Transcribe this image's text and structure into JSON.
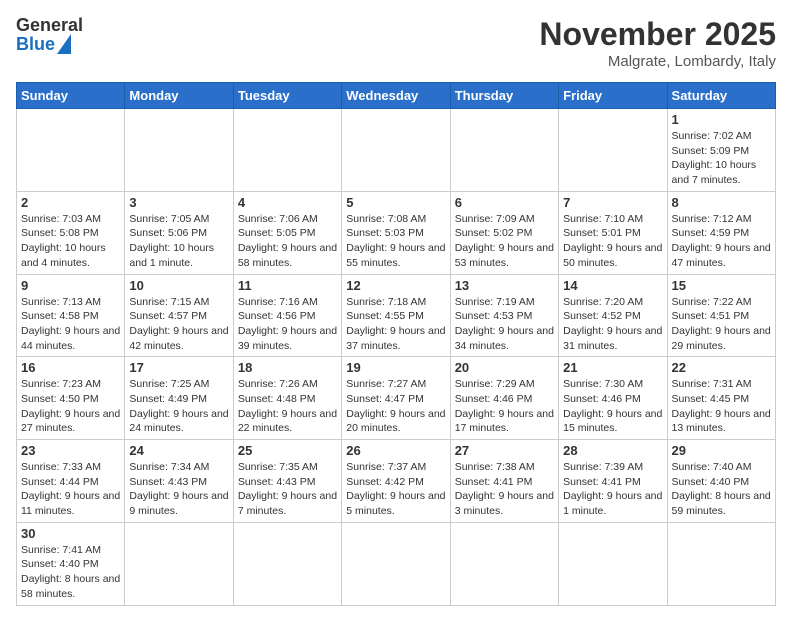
{
  "header": {
    "logo_general": "General",
    "logo_blue": "Blue",
    "month_year": "November 2025",
    "location": "Malgrate, Lombardy, Italy"
  },
  "weekdays": [
    "Sunday",
    "Monday",
    "Tuesday",
    "Wednesday",
    "Thursday",
    "Friday",
    "Saturday"
  ],
  "weeks": [
    [
      {
        "day": "",
        "info": ""
      },
      {
        "day": "",
        "info": ""
      },
      {
        "day": "",
        "info": ""
      },
      {
        "day": "",
        "info": ""
      },
      {
        "day": "",
        "info": ""
      },
      {
        "day": "",
        "info": ""
      },
      {
        "day": "1",
        "info": "Sunrise: 7:02 AM\nSunset: 5:09 PM\nDaylight: 10 hours and 7 minutes."
      }
    ],
    [
      {
        "day": "2",
        "info": "Sunrise: 7:03 AM\nSunset: 5:08 PM\nDaylight: 10 hours and 4 minutes."
      },
      {
        "day": "3",
        "info": "Sunrise: 7:05 AM\nSunset: 5:06 PM\nDaylight: 10 hours and 1 minute."
      },
      {
        "day": "4",
        "info": "Sunrise: 7:06 AM\nSunset: 5:05 PM\nDaylight: 9 hours and 58 minutes."
      },
      {
        "day": "5",
        "info": "Sunrise: 7:08 AM\nSunset: 5:03 PM\nDaylight: 9 hours and 55 minutes."
      },
      {
        "day": "6",
        "info": "Sunrise: 7:09 AM\nSunset: 5:02 PM\nDaylight: 9 hours and 53 minutes."
      },
      {
        "day": "7",
        "info": "Sunrise: 7:10 AM\nSunset: 5:01 PM\nDaylight: 9 hours and 50 minutes."
      },
      {
        "day": "8",
        "info": "Sunrise: 7:12 AM\nSunset: 4:59 PM\nDaylight: 9 hours and 47 minutes."
      }
    ],
    [
      {
        "day": "9",
        "info": "Sunrise: 7:13 AM\nSunset: 4:58 PM\nDaylight: 9 hours and 44 minutes."
      },
      {
        "day": "10",
        "info": "Sunrise: 7:15 AM\nSunset: 4:57 PM\nDaylight: 9 hours and 42 minutes."
      },
      {
        "day": "11",
        "info": "Sunrise: 7:16 AM\nSunset: 4:56 PM\nDaylight: 9 hours and 39 minutes."
      },
      {
        "day": "12",
        "info": "Sunrise: 7:18 AM\nSunset: 4:55 PM\nDaylight: 9 hours and 37 minutes."
      },
      {
        "day": "13",
        "info": "Sunrise: 7:19 AM\nSunset: 4:53 PM\nDaylight: 9 hours and 34 minutes."
      },
      {
        "day": "14",
        "info": "Sunrise: 7:20 AM\nSunset: 4:52 PM\nDaylight: 9 hours and 31 minutes."
      },
      {
        "day": "15",
        "info": "Sunrise: 7:22 AM\nSunset: 4:51 PM\nDaylight: 9 hours and 29 minutes."
      }
    ],
    [
      {
        "day": "16",
        "info": "Sunrise: 7:23 AM\nSunset: 4:50 PM\nDaylight: 9 hours and 27 minutes."
      },
      {
        "day": "17",
        "info": "Sunrise: 7:25 AM\nSunset: 4:49 PM\nDaylight: 9 hours and 24 minutes."
      },
      {
        "day": "18",
        "info": "Sunrise: 7:26 AM\nSunset: 4:48 PM\nDaylight: 9 hours and 22 minutes."
      },
      {
        "day": "19",
        "info": "Sunrise: 7:27 AM\nSunset: 4:47 PM\nDaylight: 9 hours and 20 minutes."
      },
      {
        "day": "20",
        "info": "Sunrise: 7:29 AM\nSunset: 4:46 PM\nDaylight: 9 hours and 17 minutes."
      },
      {
        "day": "21",
        "info": "Sunrise: 7:30 AM\nSunset: 4:46 PM\nDaylight: 9 hours and 15 minutes."
      },
      {
        "day": "22",
        "info": "Sunrise: 7:31 AM\nSunset: 4:45 PM\nDaylight: 9 hours and 13 minutes."
      }
    ],
    [
      {
        "day": "23",
        "info": "Sunrise: 7:33 AM\nSunset: 4:44 PM\nDaylight: 9 hours and 11 minutes."
      },
      {
        "day": "24",
        "info": "Sunrise: 7:34 AM\nSunset: 4:43 PM\nDaylight: 9 hours and 9 minutes."
      },
      {
        "day": "25",
        "info": "Sunrise: 7:35 AM\nSunset: 4:43 PM\nDaylight: 9 hours and 7 minutes."
      },
      {
        "day": "26",
        "info": "Sunrise: 7:37 AM\nSunset: 4:42 PM\nDaylight: 9 hours and 5 minutes."
      },
      {
        "day": "27",
        "info": "Sunrise: 7:38 AM\nSunset: 4:41 PM\nDaylight: 9 hours and 3 minutes."
      },
      {
        "day": "28",
        "info": "Sunrise: 7:39 AM\nSunset: 4:41 PM\nDaylight: 9 hours and 1 minute."
      },
      {
        "day": "29",
        "info": "Sunrise: 7:40 AM\nSunset: 4:40 PM\nDaylight: 8 hours and 59 minutes."
      }
    ],
    [
      {
        "day": "30",
        "info": "Sunrise: 7:41 AM\nSunset: 4:40 PM\nDaylight: 8 hours and 58 minutes."
      },
      {
        "day": "",
        "info": ""
      },
      {
        "day": "",
        "info": ""
      },
      {
        "day": "",
        "info": ""
      },
      {
        "day": "",
        "info": ""
      },
      {
        "day": "",
        "info": ""
      },
      {
        "day": "",
        "info": ""
      }
    ]
  ]
}
